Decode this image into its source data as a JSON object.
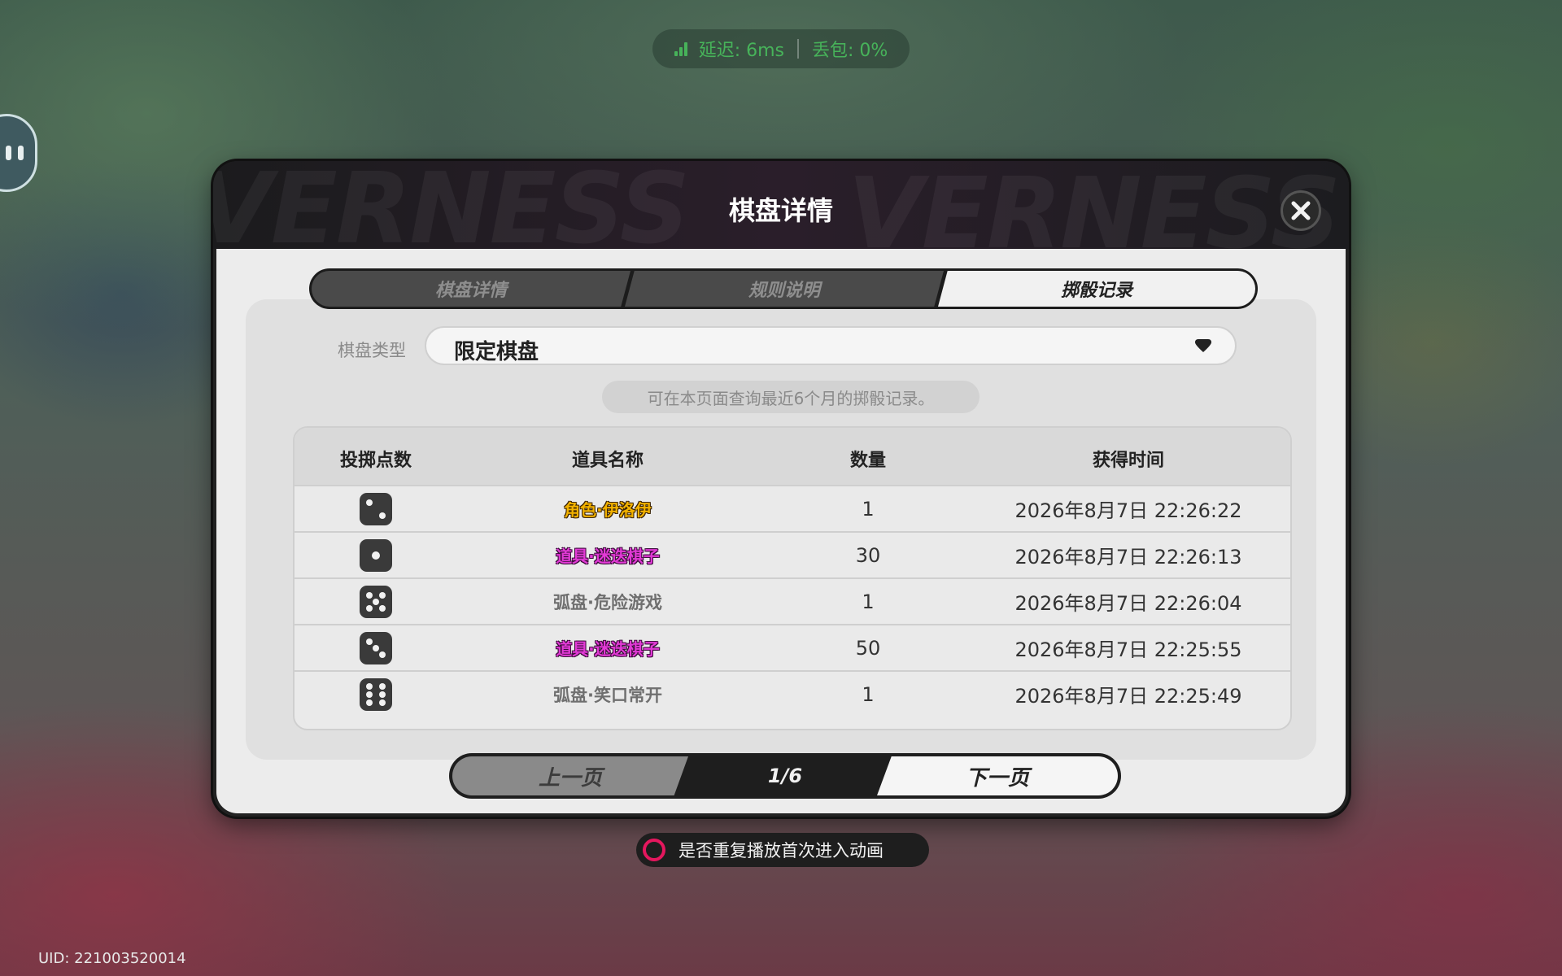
{
  "network": {
    "latency": "延迟: 6ms",
    "packet_loss": "丢包: 0%"
  },
  "modal": {
    "title": "棋盘详情",
    "tabs": [
      {
        "label": "棋盘详情",
        "active": false
      },
      {
        "label": "规则说明",
        "active": false
      },
      {
        "label": "掷骰记录",
        "active": true
      }
    ],
    "board_type_label": "棋盘类型",
    "board_type_value": "限定棋盘",
    "hint": "可在本页面查询最近6个月的掷骰记录。",
    "table": {
      "headers": [
        "投掷点数",
        "道具名称",
        "数量",
        "获得时间"
      ],
      "rows": [
        {
          "roll": 2,
          "item": "角色·伊洛伊",
          "item_color": "#f2b200",
          "qty": "1",
          "time": "2026年8月7日 22:26:22"
        },
        {
          "roll": 1,
          "item": "道具·迷迭棋子",
          "item_color": "#e23ad6",
          "qty": "30",
          "time": "2026年8月7日 22:26:13"
        },
        {
          "roll": 5,
          "item": "弧盘·危险游戏",
          "item_color": "#6f6f6f",
          "qty": "1",
          "time": "2026年8月7日 22:26:04"
        },
        {
          "roll": 3,
          "item": "道具·迷迭棋子",
          "item_color": "#e23ad6",
          "qty": "50",
          "time": "2026年8月7日 22:25:55"
        },
        {
          "roll": 6,
          "item": "弧盘·笑口常开",
          "item_color": "#6f6f6f",
          "qty": "1",
          "time": "2026年8月7日 22:25:49"
        }
      ]
    },
    "pager": {
      "prev_label": "上一页",
      "page": "1/6",
      "next_label": "下一页"
    }
  },
  "replay_toggle_label": "是否重复播放首次进入动画",
  "uid": "UID: 221003520014",
  "colors": {
    "latency_green": "#47b35a",
    "replay_ring": "#e5175e",
    "rarity_gold": "#f2b200",
    "rarity_pink": "#e23ad6"
  }
}
